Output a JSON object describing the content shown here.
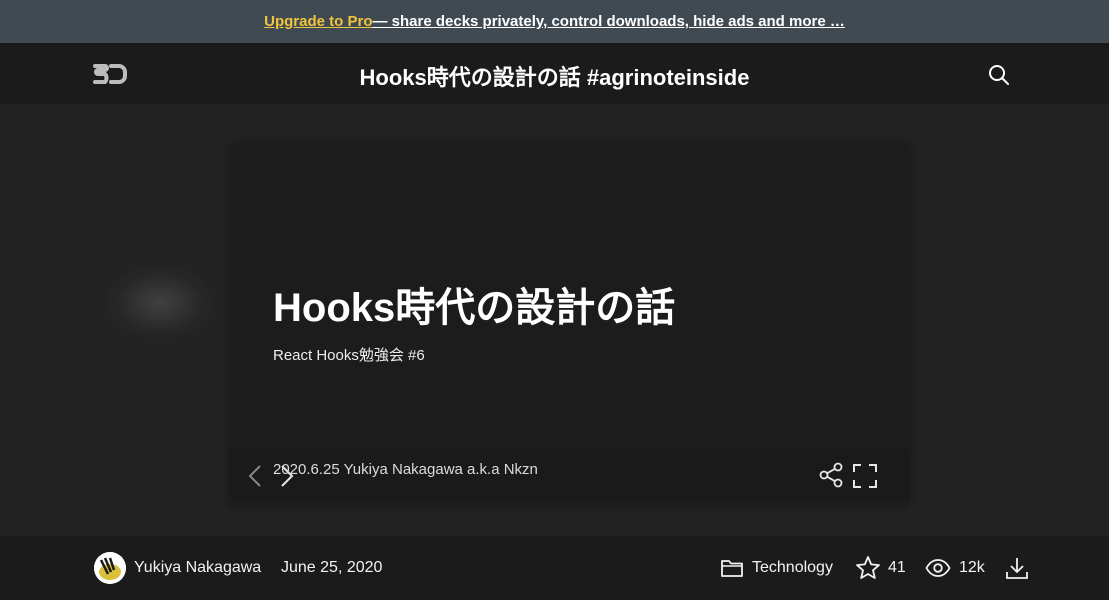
{
  "promo": {
    "link_label": "Upgrade to Pro",
    "text": " — share decks privately, control downloads, hide ads and more …"
  },
  "header": {
    "logo_icon": "speakerdeck-logo-icon",
    "title": "Hooks時代の設計の話 #agrinoteinside",
    "search_icon": "search-icon"
  },
  "slide": {
    "title": "Hooks時代の設計の話",
    "subtitle": "React Hooks勉強会 #6",
    "meta": "2020.6.25 Yukiya Nakagawa a.k.a Nkzn"
  },
  "footer": {
    "author": "Yukiya Nakagawa",
    "date": "June 25, 2020",
    "category": "Technology",
    "stars": "41",
    "views": "12k"
  },
  "colors": {
    "promo_bg": "#3f4a52",
    "pro_link": "#f0c43c",
    "bar_bg": "#1b1b1b",
    "stage_bg": "#232323",
    "slide_bg": "#1c1c1c"
  }
}
